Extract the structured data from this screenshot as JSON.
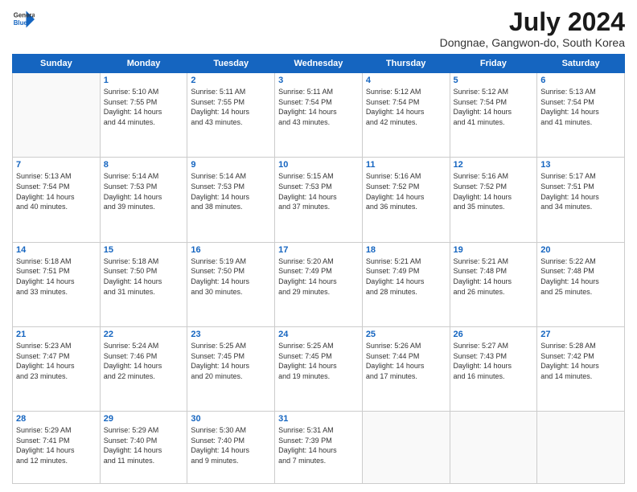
{
  "logo": {
    "line1": "General",
    "line2": "Blue"
  },
  "title": "July 2024",
  "location": "Dongnae, Gangwon-do, South Korea",
  "headers": [
    "Sunday",
    "Monday",
    "Tuesday",
    "Wednesday",
    "Thursday",
    "Friday",
    "Saturday"
  ],
  "weeks": [
    [
      {
        "day": "",
        "info": ""
      },
      {
        "day": "1",
        "info": "Sunrise: 5:10 AM\nSunset: 7:55 PM\nDaylight: 14 hours\nand 44 minutes."
      },
      {
        "day": "2",
        "info": "Sunrise: 5:11 AM\nSunset: 7:55 PM\nDaylight: 14 hours\nand 43 minutes."
      },
      {
        "day": "3",
        "info": "Sunrise: 5:11 AM\nSunset: 7:54 PM\nDaylight: 14 hours\nand 43 minutes."
      },
      {
        "day": "4",
        "info": "Sunrise: 5:12 AM\nSunset: 7:54 PM\nDaylight: 14 hours\nand 42 minutes."
      },
      {
        "day": "5",
        "info": "Sunrise: 5:12 AM\nSunset: 7:54 PM\nDaylight: 14 hours\nand 41 minutes."
      },
      {
        "day": "6",
        "info": "Sunrise: 5:13 AM\nSunset: 7:54 PM\nDaylight: 14 hours\nand 41 minutes."
      }
    ],
    [
      {
        "day": "7",
        "info": "Sunrise: 5:13 AM\nSunset: 7:54 PM\nDaylight: 14 hours\nand 40 minutes."
      },
      {
        "day": "8",
        "info": "Sunrise: 5:14 AM\nSunset: 7:53 PM\nDaylight: 14 hours\nand 39 minutes."
      },
      {
        "day": "9",
        "info": "Sunrise: 5:14 AM\nSunset: 7:53 PM\nDaylight: 14 hours\nand 38 minutes."
      },
      {
        "day": "10",
        "info": "Sunrise: 5:15 AM\nSunset: 7:53 PM\nDaylight: 14 hours\nand 37 minutes."
      },
      {
        "day": "11",
        "info": "Sunrise: 5:16 AM\nSunset: 7:52 PM\nDaylight: 14 hours\nand 36 minutes."
      },
      {
        "day": "12",
        "info": "Sunrise: 5:16 AM\nSunset: 7:52 PM\nDaylight: 14 hours\nand 35 minutes."
      },
      {
        "day": "13",
        "info": "Sunrise: 5:17 AM\nSunset: 7:51 PM\nDaylight: 14 hours\nand 34 minutes."
      }
    ],
    [
      {
        "day": "14",
        "info": "Sunrise: 5:18 AM\nSunset: 7:51 PM\nDaylight: 14 hours\nand 33 minutes."
      },
      {
        "day": "15",
        "info": "Sunrise: 5:18 AM\nSunset: 7:50 PM\nDaylight: 14 hours\nand 31 minutes."
      },
      {
        "day": "16",
        "info": "Sunrise: 5:19 AM\nSunset: 7:50 PM\nDaylight: 14 hours\nand 30 minutes."
      },
      {
        "day": "17",
        "info": "Sunrise: 5:20 AM\nSunset: 7:49 PM\nDaylight: 14 hours\nand 29 minutes."
      },
      {
        "day": "18",
        "info": "Sunrise: 5:21 AM\nSunset: 7:49 PM\nDaylight: 14 hours\nand 28 minutes."
      },
      {
        "day": "19",
        "info": "Sunrise: 5:21 AM\nSunset: 7:48 PM\nDaylight: 14 hours\nand 26 minutes."
      },
      {
        "day": "20",
        "info": "Sunrise: 5:22 AM\nSunset: 7:48 PM\nDaylight: 14 hours\nand 25 minutes."
      }
    ],
    [
      {
        "day": "21",
        "info": "Sunrise: 5:23 AM\nSunset: 7:47 PM\nDaylight: 14 hours\nand 23 minutes."
      },
      {
        "day": "22",
        "info": "Sunrise: 5:24 AM\nSunset: 7:46 PM\nDaylight: 14 hours\nand 22 minutes."
      },
      {
        "day": "23",
        "info": "Sunrise: 5:25 AM\nSunset: 7:45 PM\nDaylight: 14 hours\nand 20 minutes."
      },
      {
        "day": "24",
        "info": "Sunrise: 5:25 AM\nSunset: 7:45 PM\nDaylight: 14 hours\nand 19 minutes."
      },
      {
        "day": "25",
        "info": "Sunrise: 5:26 AM\nSunset: 7:44 PM\nDaylight: 14 hours\nand 17 minutes."
      },
      {
        "day": "26",
        "info": "Sunrise: 5:27 AM\nSunset: 7:43 PM\nDaylight: 14 hours\nand 16 minutes."
      },
      {
        "day": "27",
        "info": "Sunrise: 5:28 AM\nSunset: 7:42 PM\nDaylight: 14 hours\nand 14 minutes."
      }
    ],
    [
      {
        "day": "28",
        "info": "Sunrise: 5:29 AM\nSunset: 7:41 PM\nDaylight: 14 hours\nand 12 minutes."
      },
      {
        "day": "29",
        "info": "Sunrise: 5:29 AM\nSunset: 7:40 PM\nDaylight: 14 hours\nand 11 minutes."
      },
      {
        "day": "30",
        "info": "Sunrise: 5:30 AM\nSunset: 7:40 PM\nDaylight: 14 hours\nand 9 minutes."
      },
      {
        "day": "31",
        "info": "Sunrise: 5:31 AM\nSunset: 7:39 PM\nDaylight: 14 hours\nand 7 minutes."
      },
      {
        "day": "",
        "info": ""
      },
      {
        "day": "",
        "info": ""
      },
      {
        "day": "",
        "info": ""
      }
    ]
  ]
}
